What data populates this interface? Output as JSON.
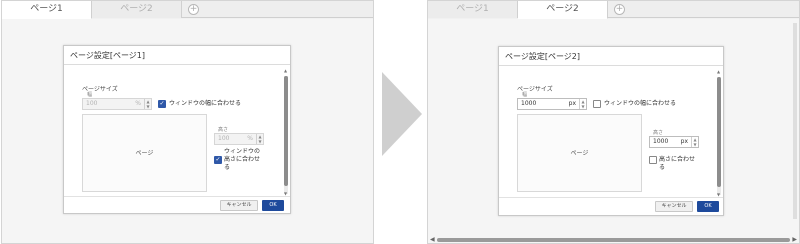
{
  "left_panel": {
    "tabs": [
      {
        "label": "ページ1",
        "active": true
      },
      {
        "label": "ページ2",
        "active": false
      }
    ],
    "add_tab_icon": "plus-circle-icon",
    "dialog": {
      "title": "ページ設定[ページ1]",
      "page_size_label": "ページサイズ",
      "width_label": "幅",
      "width_value": "100",
      "width_unit": "%",
      "fit_width_checked": true,
      "fit_width_label": "ウィンドウの幅に合わせる",
      "page_label": "ページ",
      "height_label": "高さ",
      "height_value": "100",
      "height_unit": "%",
      "fit_height_checked": true,
      "fit_height_label_line1": "ウィンドウの",
      "fit_height_label_line2": "高さに合わせ",
      "fit_height_label_line3": "る",
      "cancel_label": "キャンセル",
      "ok_label": "OK"
    }
  },
  "right_panel": {
    "tabs": [
      {
        "label": "ページ1",
        "active": false
      },
      {
        "label": "ページ2",
        "active": true
      }
    ],
    "add_tab_icon": "plus-circle-icon",
    "dialog": {
      "title": "ページ設定[ページ2]",
      "page_size_label": "ページサイズ",
      "width_label": "幅",
      "width_value": "1000",
      "width_unit": "px",
      "fit_width_checked": false,
      "fit_width_label": "ウィンドウの幅に合わせる",
      "page_label": "ページ",
      "height_label": "高さ",
      "height_value": "1000",
      "height_unit": "px",
      "fit_height_checked": false,
      "fit_height_label_line1": "高さに合わせ",
      "fit_height_label_line2": "る",
      "cancel_label": "キャンセル",
      "ok_label": "OK"
    }
  },
  "transition_arrow_icon": "arrow-right-icon",
  "colors": {
    "accent": "#1e4a9c",
    "checkbox_checked": "#2f58a8",
    "arrow": "#cfcfcf"
  }
}
